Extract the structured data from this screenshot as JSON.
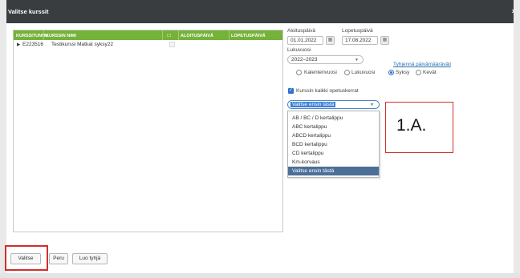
{
  "window": {
    "title": "Valitse kurssit",
    "close_symbol": "×"
  },
  "course_table": {
    "columns": [
      "KURSSITUNNU",
      "KURSSIN NIMI",
      "☐",
      "ALOITUSPÄIVÄ",
      "LOPETUSPÄIVÄ"
    ],
    "rows": [
      {
        "expand": "▶",
        "code": "E223516",
        "name": "Testikurssi Matkat syksy22",
        "start": "",
        "end": ""
      }
    ]
  },
  "filters": {
    "start_label": "Aloituspäivä",
    "start_value": "01.01.2022",
    "end_label": "Lopetuspäivä",
    "end_value": "17.08.2022",
    "year_label": "Lukuvuosi",
    "year_value": "2022–2023",
    "clear_dates_link": "Tyhjennä päivämääräväli",
    "year_type_options": [
      {
        "label": "Kalenterivuosi",
        "selected": false
      },
      {
        "label": "Lukuvuosi",
        "selected": false
      }
    ],
    "term_options": [
      {
        "label": "Syksy",
        "selected": true
      },
      {
        "label": "Kevät",
        "selected": false
      }
    ],
    "all_sessions_label": "Kurssin kaikki opetuskerrat",
    "all_sessions_checked": true
  },
  "session_dropdown": {
    "selected": "Valitse ensin tästä",
    "options": [
      "AB / BC / D kertalippu",
      "ABC kertalippu",
      "ABCD kertalippu",
      "BCD kertalippu",
      "CD kertalippu",
      "Km-korvaus",
      "Valitse ensin tästä"
    ],
    "highlighted_index": 6
  },
  "annotation": {
    "text": "1.A."
  },
  "buttons": {
    "select": "Valitse",
    "cancel": "Peru",
    "create_empty": "Luo tyhjä"
  },
  "colors": {
    "titlebar": "#3a3d40",
    "table_header": "#75b23a",
    "highlight": "#4b6f97",
    "annotation_border": "#d0302b"
  }
}
